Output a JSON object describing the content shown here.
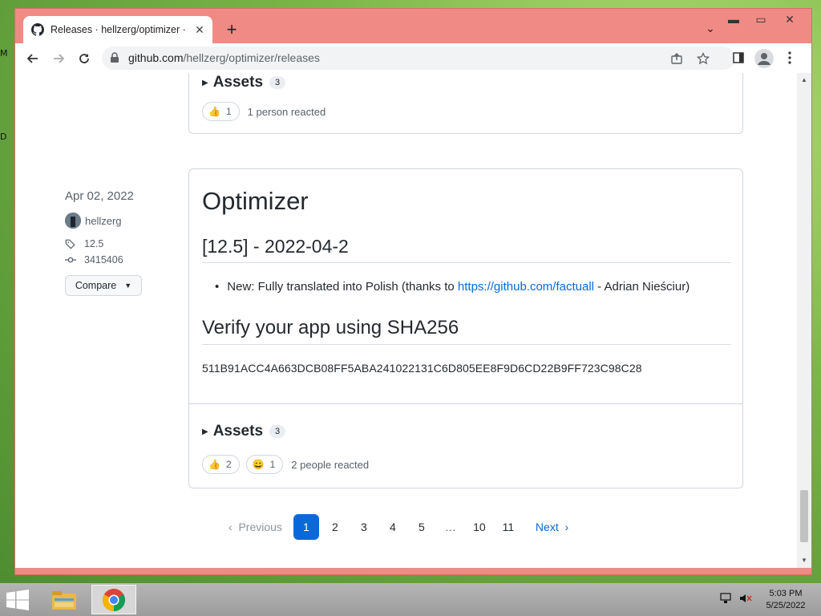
{
  "browser": {
    "tab_title": "Releases · hellzerg/optimizer · GitHub",
    "url_host": "github.com",
    "url_path": "/hellzerg/optimizer/releases"
  },
  "prev_release": {
    "assets_label": "Assets",
    "assets_count": "3",
    "reactions": [
      {
        "emoji": "👍",
        "count": "1"
      }
    ],
    "reacted_text": "1 person reacted"
  },
  "release": {
    "date": "Apr 02, 2022",
    "author": "hellzerg",
    "tag": "12.5",
    "commit": "3415406",
    "compare_label": "Compare",
    "title": "Optimizer",
    "version_heading": "[12.5] - 2022-04-2",
    "change_text": "New: Fully translated into Polish (thanks to ",
    "change_link": "https://github.com/factuall",
    "change_suffix": " - Adrian Nieściur)",
    "verify_heading": "Verify your app using SHA256",
    "sha256": "511B91ACC4A663DCB08FF5ABA241022131C6D805EE8F9D6CD22B9FF723C98C28",
    "assets_label": "Assets",
    "assets_count": "3",
    "reactions": [
      {
        "emoji": "👍",
        "count": "2"
      },
      {
        "emoji": "😄",
        "count": "1"
      }
    ],
    "reacted_text": "2 people reacted"
  },
  "pagination": {
    "previous": "Previous",
    "pages": [
      "1",
      "2",
      "3",
      "4",
      "5",
      "…",
      "10",
      "11"
    ],
    "current": "1",
    "next": "Next"
  },
  "taskbar": {
    "time": "5:03 PM",
    "date": "5/25/2022"
  },
  "colors": {
    "accent": "#0969da",
    "window_frame": "#f08a85"
  }
}
